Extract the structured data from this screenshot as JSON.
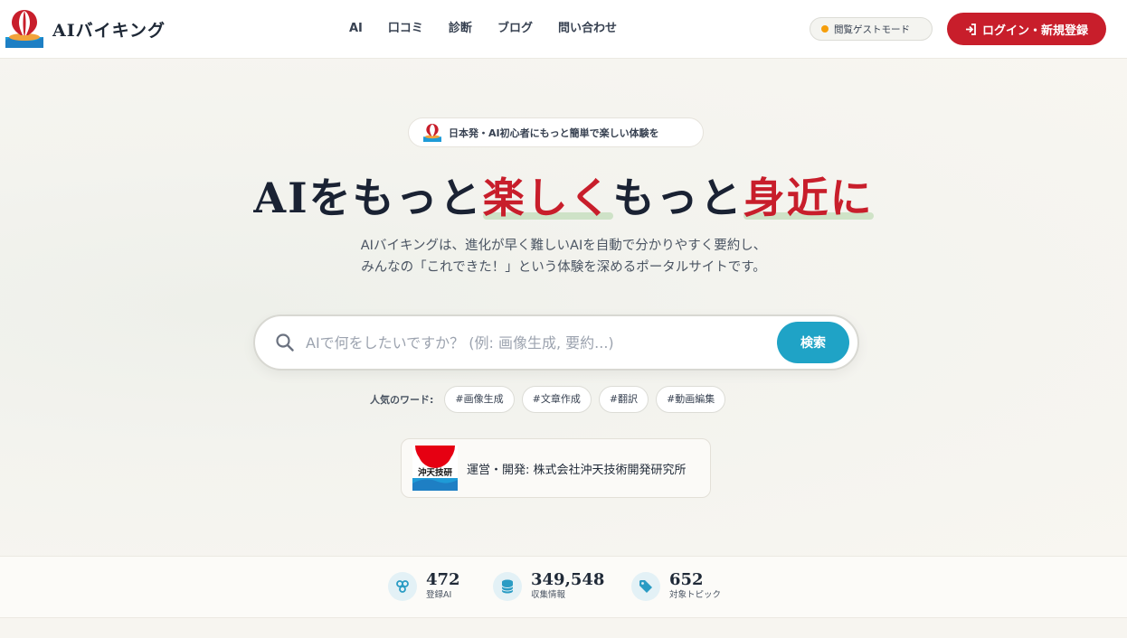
{
  "brand": {
    "name": "AIバイキング"
  },
  "nav": [
    "AI",
    "口コミ",
    "診断",
    "ブログ",
    "問い合わせ"
  ],
  "guest_mode": {
    "label": "閲覧ゲストモード",
    "dot_color": "#f59e0b"
  },
  "login": {
    "label": "ログイン・新規登録",
    "icon": "sign-in-icon"
  },
  "hero": {
    "tagline": "日本発・AI初心者にもっと簡単で楽しい体験を",
    "headline": {
      "part1": "AIをもっと",
      "accent1": "楽しく",
      "part2": "もっと",
      "accent2": "身近に"
    },
    "description_line1": "AIバイキングは、進化が早く難しいAIを自動で分かりやすく要約し、",
    "description_line2": "みんなの「これできた！」という体験を深めるポータルサイトです。"
  },
  "search": {
    "placeholder": "AIで何をしたいですか？ (例: 画像生成, 要約...)",
    "button": "検索"
  },
  "popular": {
    "label": "人気のワード:",
    "chips": [
      "#画像生成",
      "#文章作成",
      "#翻訳",
      "#動画編集"
    ]
  },
  "operator": {
    "logo_text": "沖天技研",
    "text": "運営・開発: 株式会社沖天技術開発研究所"
  },
  "stats": [
    {
      "value": "472",
      "label": "登録AI",
      "icon": "robot-icon"
    },
    {
      "value": "349,548",
      "label": "収集情報",
      "icon": "database-icon"
    },
    {
      "value": "652",
      "label": "対象トピック",
      "icon": "tag-icon"
    }
  ],
  "colors": {
    "accent_red": "#c81e2b",
    "search_blue": "#1fa3c6",
    "icon_blue": "#2a9cc4"
  }
}
